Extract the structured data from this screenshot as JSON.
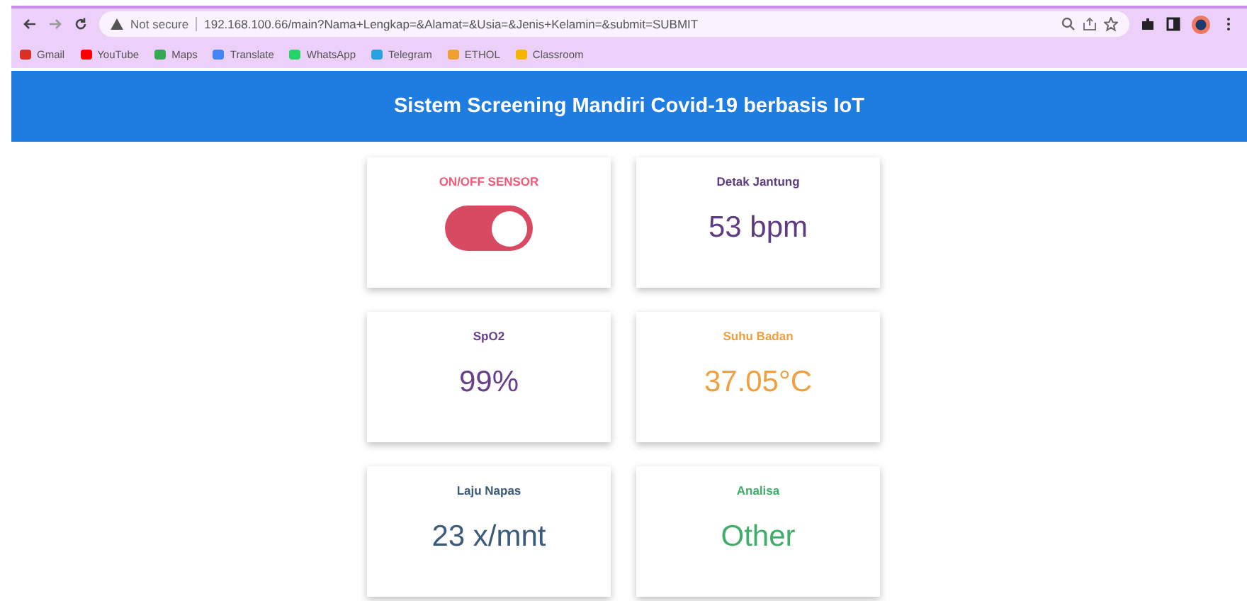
{
  "browser": {
    "url_prefix": "Not secure",
    "url": "192.168.100.66/main?Nama+Lengkap=&Alamat=&Usia=&Jenis+Kelamin=&submit=SUBMIT",
    "bookmarks": [
      {
        "label": "Gmail",
        "color": "#d93025"
      },
      {
        "label": "YouTube",
        "color": "#ff0000"
      },
      {
        "label": "Maps",
        "color": "#34a853"
      },
      {
        "label": "Translate",
        "color": "#4285f4"
      },
      {
        "label": "WhatsApp",
        "color": "#25d366"
      },
      {
        "label": "Telegram",
        "color": "#2aa1de"
      },
      {
        "label": "ETHOL",
        "color": "#f0a030"
      },
      {
        "label": "Classroom",
        "color": "#f4b400"
      }
    ]
  },
  "header": {
    "title": "Sistem Screening Mandiri Covid-19 berbasis IoT"
  },
  "cards": [
    {
      "kind": "switch",
      "label": "ON/OFF SENSOR",
      "on": true,
      "color": "#f05a78"
    },
    {
      "kind": "reading",
      "label": "Detak Jantung",
      "value": "53 bpm",
      "color": "#5e3c82"
    },
    {
      "kind": "reading",
      "label": "SpO2",
      "value": "99%",
      "color": "#6a3f8a"
    },
    {
      "kind": "reading",
      "label": "Suhu Badan",
      "value": "37.05°C",
      "color": "#f0a040"
    },
    {
      "kind": "reading",
      "label": "Laju Napas",
      "value": "23 x/mnt",
      "color": "#3c5a7c"
    },
    {
      "kind": "reading",
      "label": "Analisa",
      "value": "Other",
      "color": "#3fae68"
    }
  ]
}
